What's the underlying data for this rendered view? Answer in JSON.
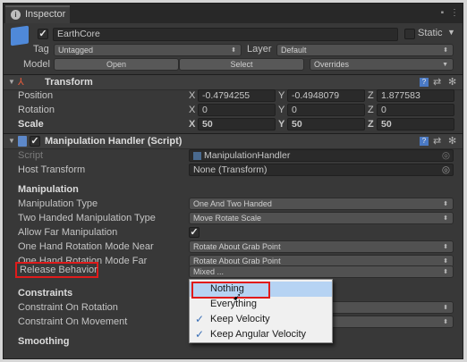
{
  "tab": {
    "title": "Inspector"
  },
  "object": {
    "name": "EarthCore",
    "static_label": "Static",
    "tag_label": "Tag",
    "tag_value": "Untagged",
    "layer_label": "Layer",
    "layer_value": "Default",
    "model_label": "Model",
    "model_buttons": [
      "Open",
      "Select",
      "Overrides"
    ]
  },
  "transform": {
    "title": "Transform",
    "rows": [
      {
        "label": "Position",
        "x": "-0.4794255",
        "y": "-0.4948079",
        "z": "1.877583"
      },
      {
        "label": "Rotation",
        "x": "0",
        "y": "0",
        "z": "0"
      },
      {
        "label": "Scale",
        "x": "50",
        "y": "50",
        "z": "50"
      }
    ],
    "axes": [
      "X",
      "Y",
      "Z"
    ]
  },
  "manipulation_handler": {
    "title": "Manipulation Handler (Script)",
    "script_label": "Script",
    "script_value": "ManipulationHandler",
    "host_label": "Host Transform",
    "host_value": "None (Transform)",
    "manipulation_header": "Manipulation",
    "manipulation_type_label": "Manipulation Type",
    "manipulation_type_value": "One And Two Handed",
    "two_handed_label": "Two Handed Manipulation Type",
    "two_handed_value": "Move Rotate Scale",
    "allow_far_label": "Allow Far Manipulation",
    "one_hand_near_label": "One Hand Rotation Mode Near",
    "one_hand_near_value": "Rotate About Grab Point",
    "one_hand_far_label": "One Hand Rotation Mode Far",
    "one_hand_far_value": "Rotate About Grab Point",
    "release_label": "Release Behavior",
    "release_value": "Mixed ...",
    "constraints_header": "Constraints",
    "constraint_rotation_label": "Constraint On Rotation",
    "constraint_movement_label": "Constraint On Movement",
    "smoothing_header": "Smoothing"
  },
  "popup": {
    "items": [
      {
        "label": "Nothing",
        "checked": false
      },
      {
        "label": "Everything",
        "checked": false
      },
      {
        "label": "Keep Velocity",
        "checked": true
      },
      {
        "label": "Keep Angular Velocity",
        "checked": true
      }
    ]
  },
  "colors": {
    "highlight": "#e01b1b",
    "menu_hover": "#b6d3f3"
  }
}
